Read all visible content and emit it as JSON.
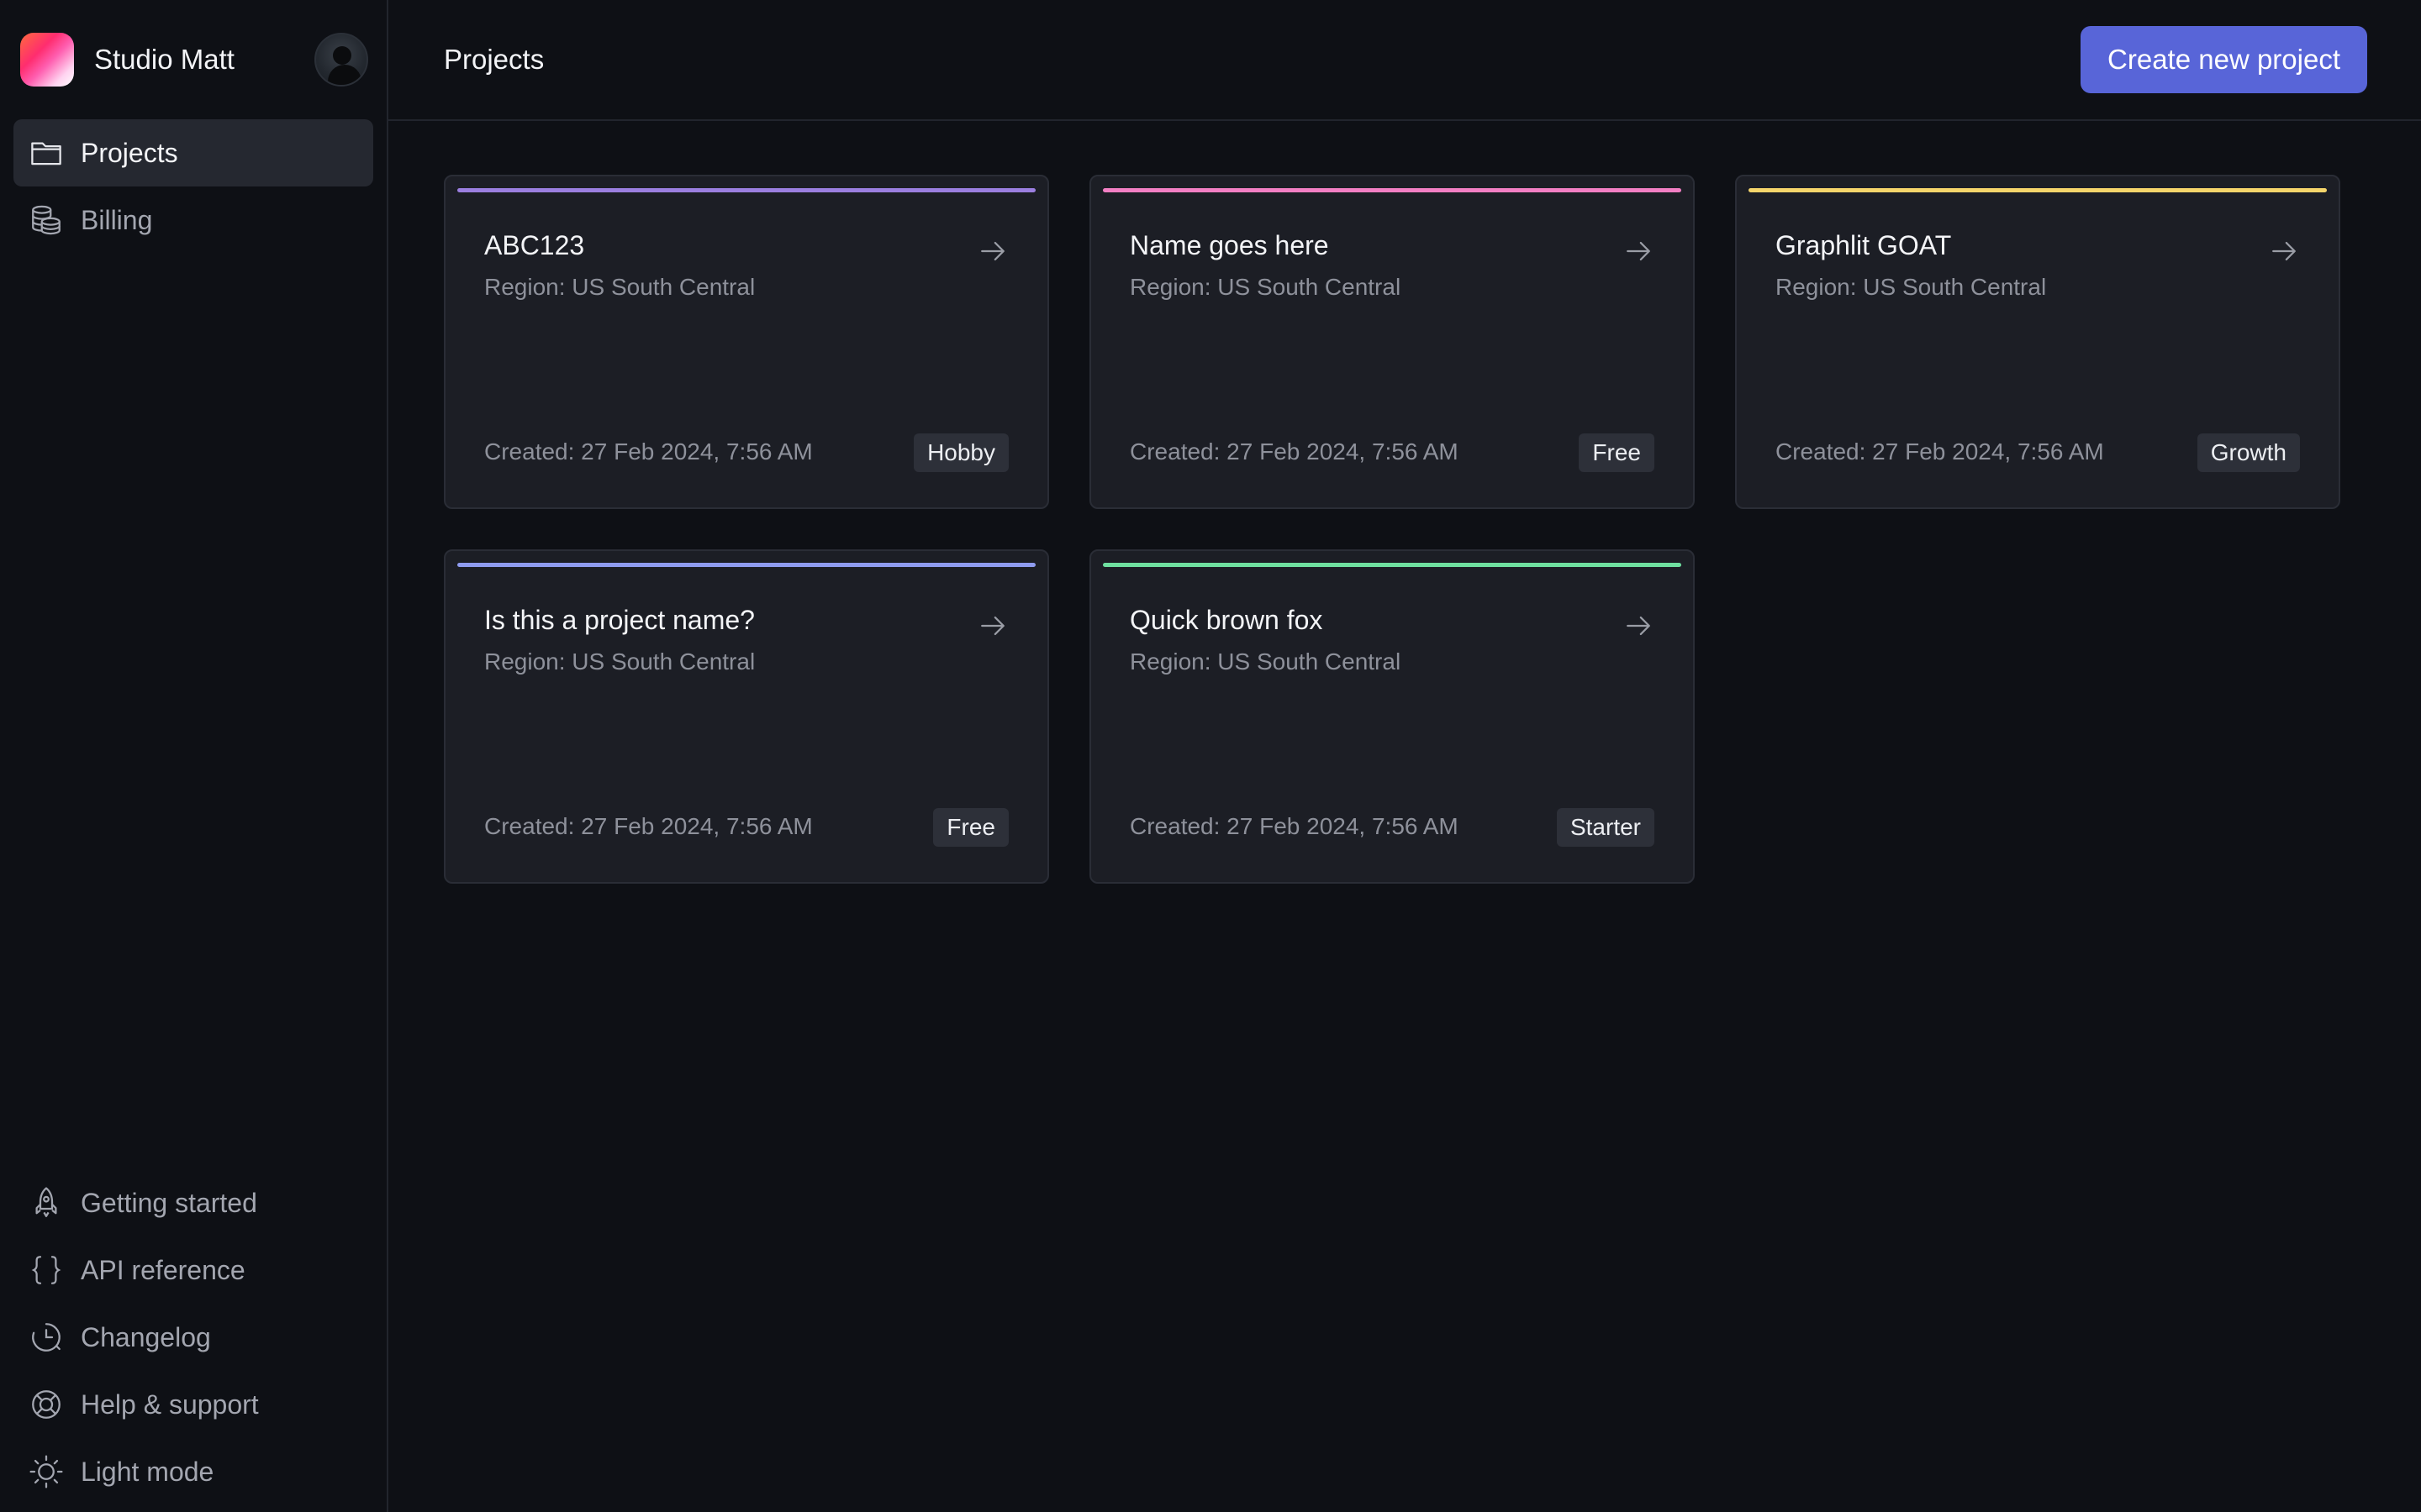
{
  "sidebar": {
    "brand_name": "Studio Matt",
    "top_items": [
      {
        "label": "Projects",
        "icon": "folder-icon",
        "active": true
      },
      {
        "label": "Billing",
        "icon": "coins-icon",
        "active": false
      }
    ],
    "bottom_items": [
      {
        "label": "Getting started",
        "icon": "rocket-icon"
      },
      {
        "label": "API reference",
        "icon": "braces-icon"
      },
      {
        "label": "Changelog",
        "icon": "clock-history-icon"
      },
      {
        "label": "Help & support",
        "icon": "lifebuoy-icon"
      },
      {
        "label": "Light mode",
        "icon": "sun-icon"
      }
    ]
  },
  "header": {
    "title": "Projects",
    "create_label": "Create new project"
  },
  "projects": [
    {
      "name": "ABC123",
      "region": "Region: US South Central",
      "created": "Created: 27 Feb 2024, 7:56 AM",
      "plan": "Hobby",
      "accent": "#9b7fe0"
    },
    {
      "name": "Name goes here",
      "region": "Region: US South Central",
      "created": "Created: 27 Feb 2024, 7:56 AM",
      "plan": "Free",
      "accent": "#f27fc4"
    },
    {
      "name": "Graphlit GOAT",
      "region": "Region: US South Central",
      "created": "Created: 27 Feb 2024, 7:56 AM",
      "plan": "Growth",
      "accent": "#f5d56b"
    },
    {
      "name": "Is this a project name?",
      "region": "Region: US South Central",
      "created": "Created: 27 Feb 2024, 7:56 AM",
      "plan": "Free",
      "accent": "#8f9cf0"
    },
    {
      "name": "Quick brown fox",
      "region": "Region: US South Central",
      "created": "Created: 27 Feb 2024, 7:56 AM",
      "plan": "Starter",
      "accent": "#6fe0a0"
    }
  ]
}
